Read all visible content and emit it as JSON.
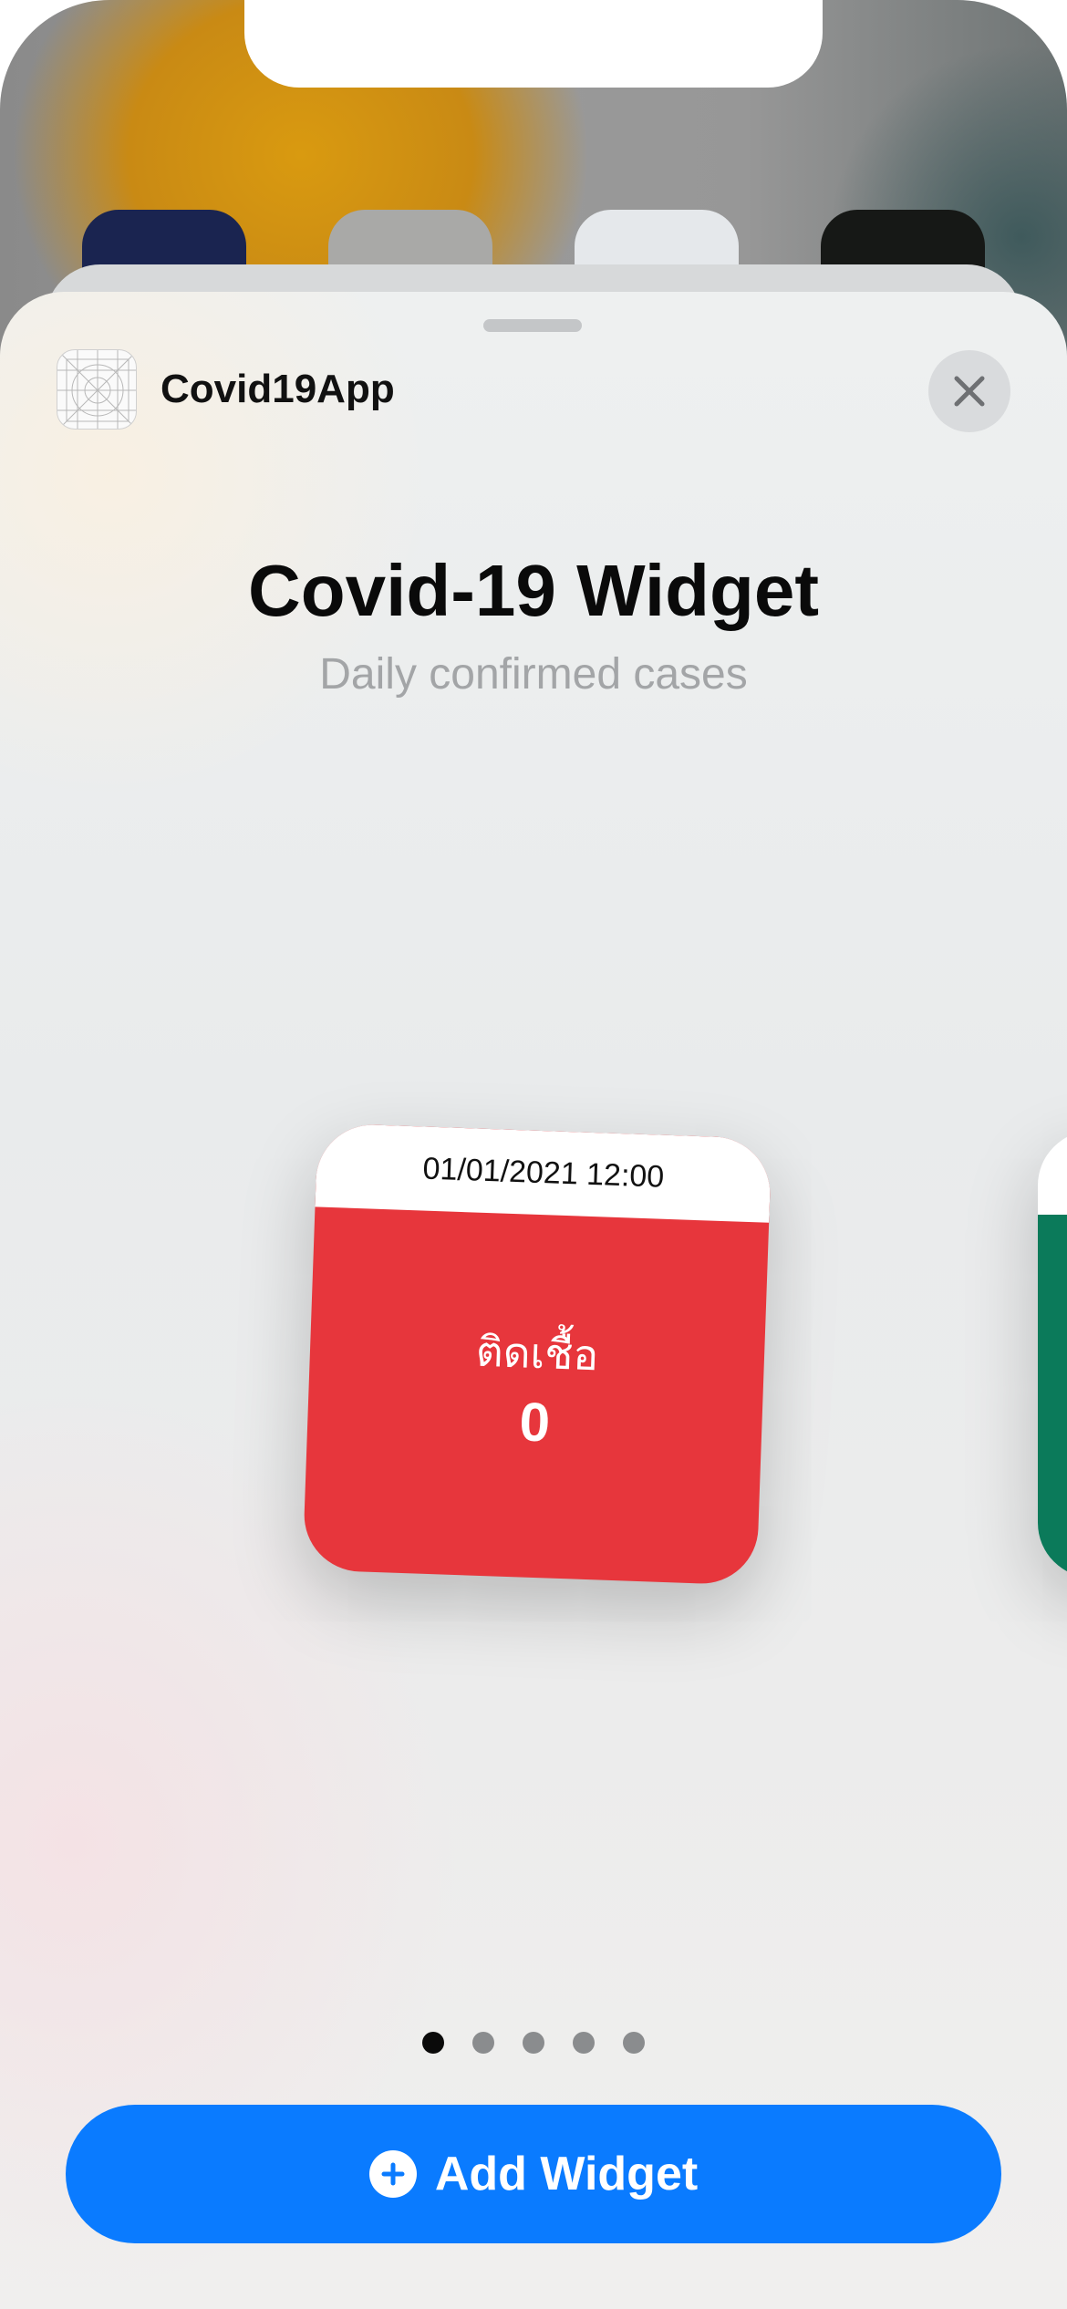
{
  "app": {
    "name": "Covid19App",
    "icon": "app-placeholder-icon"
  },
  "sheet": {
    "title": "Covid-19 Widget",
    "subtitle": "Daily confirmed cases",
    "close_icon": "close-icon"
  },
  "widget": {
    "timestamp": "01/01/2021 12:00",
    "label": "ติดเชื้อ",
    "value": "0",
    "color": "#e7363c"
  },
  "next_widget": {
    "color": "#0b7a5a"
  },
  "pager": {
    "count": 5,
    "active_index": 0
  },
  "actions": {
    "add_widget_label": "Add Widget",
    "add_icon": "plus-circle-icon",
    "accent": "#0a7bff"
  }
}
